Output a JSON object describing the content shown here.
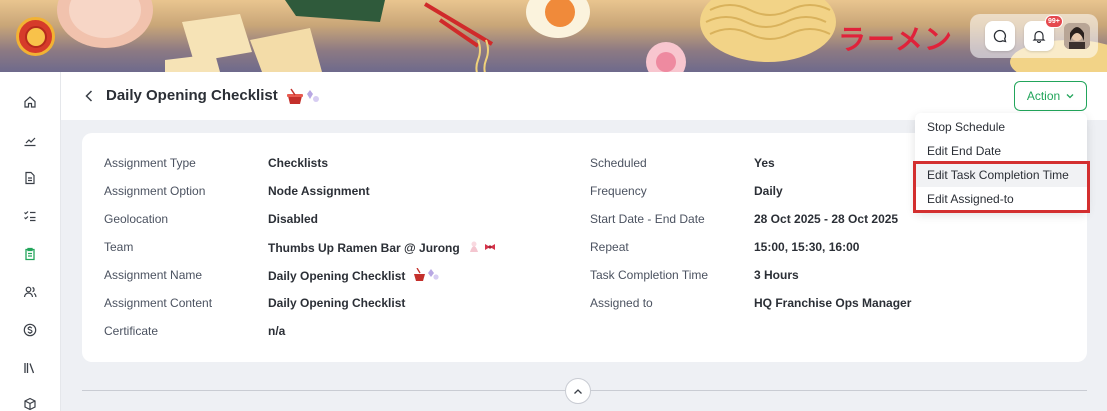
{
  "banner": {
    "kana": "ラーメン",
    "notification_count": "99+"
  },
  "header": {
    "title": "Daily Opening Checklist",
    "action_label": "Action"
  },
  "details": {
    "left": [
      {
        "label": "Assignment Type",
        "value": "Checklists"
      },
      {
        "label": "Assignment Option",
        "value": "Node Assignment"
      },
      {
        "label": "Geolocation",
        "value": "Disabled"
      },
      {
        "label": "Team",
        "value": "Thumbs Up Ramen Bar @ Jurong"
      },
      {
        "label": "Assignment Name",
        "value": "Daily Opening Checklist"
      },
      {
        "label": "Assignment Content",
        "value": "Daily Opening Checklist"
      },
      {
        "label": "Certificate",
        "value": "n/a"
      }
    ],
    "right": [
      {
        "label": "Scheduled",
        "value": "Yes"
      },
      {
        "label": "Frequency",
        "value": "Daily"
      },
      {
        "label": "Start Date - End Date",
        "value": "28 Oct 2025 - 28 Oct 2025"
      },
      {
        "label": "Repeat",
        "value": "15:00, 15:30, 16:00"
      },
      {
        "label": "Task Completion Time",
        "value": "3 Hours"
      },
      {
        "label": "Assigned to",
        "value": "HQ Franchise Ops Manager"
      }
    ]
  },
  "action_menu": {
    "items": [
      {
        "label": "Stop Schedule"
      },
      {
        "label": "Edit End Date"
      },
      {
        "label": "Edit Task Completion Time"
      },
      {
        "label": "Edit Assigned-to"
      }
    ]
  },
  "colors": {
    "accent": "#22a55b",
    "highlight": "#d32f2f"
  }
}
